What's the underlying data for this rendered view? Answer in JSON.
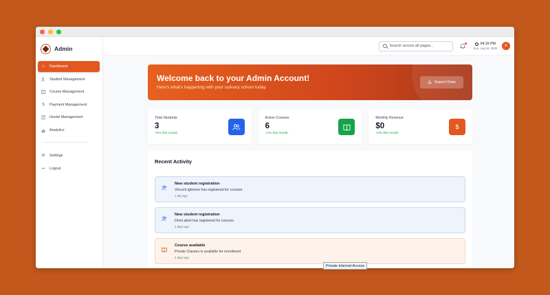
{
  "window": {
    "controls": [
      "close",
      "minimize",
      "maximize"
    ]
  },
  "sidebar": {
    "brand": "Admin",
    "items": [
      {
        "label": "Dashboard",
        "icon": "home-icon",
        "active": true
      },
      {
        "label": "Student Management",
        "icon": "users-icon"
      },
      {
        "label": "Course Management",
        "icon": "book-icon"
      },
      {
        "label": "Payment Management",
        "icon": "dollar-icon"
      },
      {
        "label": "Hostel Management",
        "icon": "building-icon"
      },
      {
        "label": "Analytics",
        "icon": "chart-icon"
      }
    ],
    "bottom_items": [
      {
        "label": "Settings",
        "icon": "gear-icon"
      },
      {
        "label": "Logout",
        "icon": "logout-icon"
      }
    ]
  },
  "topbar": {
    "search_placeholder": "Search across all pages...",
    "time": "04:16 PM",
    "date": "Sun, Aug 10, 2025",
    "avatar_initial": "A"
  },
  "banner": {
    "title": "Welcome back to your Admin Account!",
    "subtitle": "Here's what's happening with your culinary school today.",
    "export_label": "Export Data"
  },
  "stats": [
    {
      "label": "Total Students",
      "value": "3",
      "change": "+0% this month",
      "icon": "users-icon",
      "color": "#2563EB"
    },
    {
      "label": "Active Courses",
      "value": "6",
      "change": "+1% this month",
      "icon": "book-icon",
      "color": "#16A34A"
    },
    {
      "label": "Monthly Revenue",
      "value": "$0",
      "change": "+0% this month",
      "icon": "dollar-icon",
      "color": "#E2581F"
    }
  ],
  "activity": {
    "title": "Recent Activity",
    "items": [
      {
        "heading": "New student registration",
        "desc": "Vincent igbinere has registered for courses",
        "time": "1 day ago"
      },
      {
        "heading": "New student registration",
        "desc": "Demi abiol has registered for courses",
        "time": "2 days ago"
      },
      {
        "heading": "Course available",
        "desc": "Private Classes is available for enrollment",
        "time": "2 days ago"
      }
    ]
  },
  "tooltip": "Private Internet Access",
  "colors": {
    "background": "#C2581C",
    "accent": "#E2581F"
  }
}
